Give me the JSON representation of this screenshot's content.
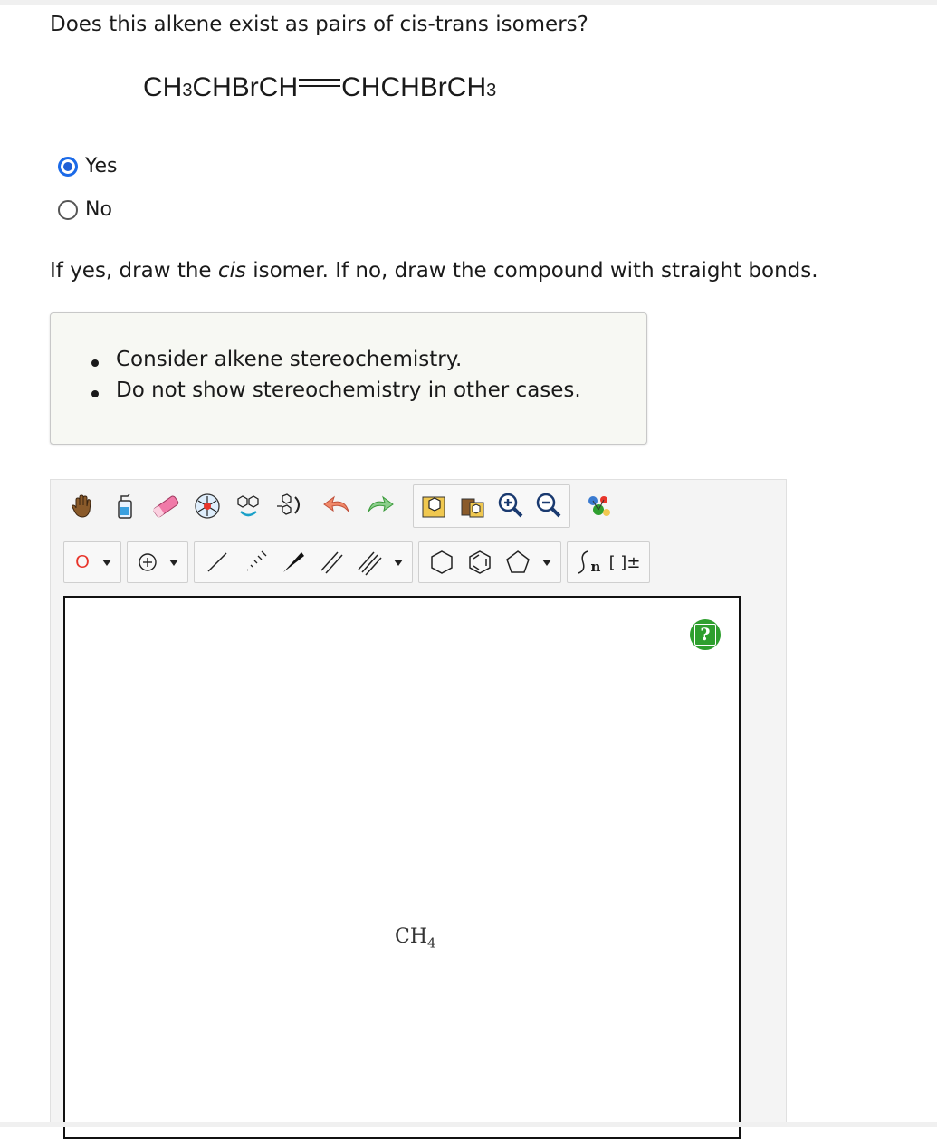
{
  "question": "Does this alkene exist as pairs of cis-trans isomers?",
  "formula": {
    "part1": "CH",
    "sub1": "3",
    "part2": "CHBrCH",
    "part3": "CHCHBrCH",
    "sub2": "3"
  },
  "options": [
    {
      "label": "Yes",
      "checked": true
    },
    {
      "label": "No",
      "checked": false
    }
  ],
  "instruction": {
    "pre": "If yes, draw the ",
    "emph": "cis",
    "post": " isomer. If no, draw the compound with straight bonds."
  },
  "hints": [
    "Consider alkene stereochemistry.",
    "Do not show stereochemistry in other cases."
  ],
  "toolbar": {
    "atom_label": "O",
    "polymer_label": "n",
    "charge_label": "[ ]±"
  },
  "canvas": {
    "molecule_main": "CH",
    "molecule_sub": "4",
    "help_label": "?"
  },
  "colors": {
    "radio_accent": "#1f5fd6",
    "atom_red": "#e8352b",
    "help_green": "#2e9f2e",
    "hint_bg": "#f7f8f3"
  }
}
